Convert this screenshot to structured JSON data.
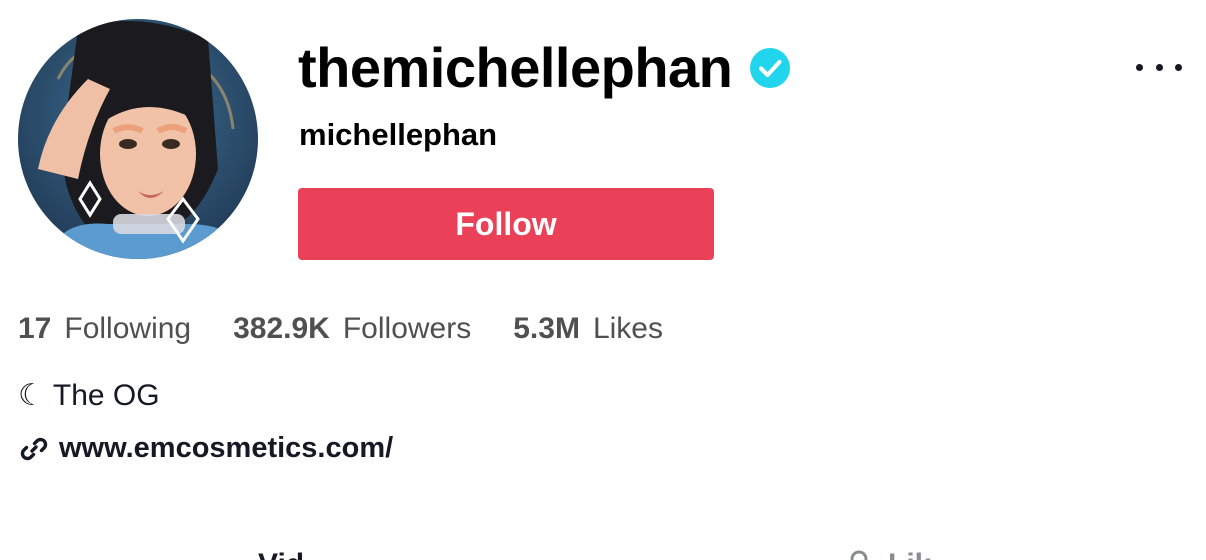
{
  "profile": {
    "username": "themichellephan",
    "nickname": "michellephan",
    "verified": true,
    "verified_color": "#20d5ec",
    "avatar_icon": "profile-photo"
  },
  "actions": {
    "follow_label": "Follow",
    "follow_color": "#ea4058",
    "more_icon": "more-dots-icon"
  },
  "stats": [
    {
      "value": "17",
      "label": "Following"
    },
    {
      "value": "382.9K",
      "label": "Followers"
    },
    {
      "value": "5.3M",
      "label": "Likes"
    }
  ],
  "bio": {
    "moon": "☾",
    "text": "The OG"
  },
  "link": {
    "icon": "link-icon",
    "url": "www.emcosmetics.com/"
  },
  "tabs": [
    {
      "label": "Vid",
      "icon": null
    },
    {
      "label": "Lik",
      "icon": "lock-icon"
    }
  ]
}
